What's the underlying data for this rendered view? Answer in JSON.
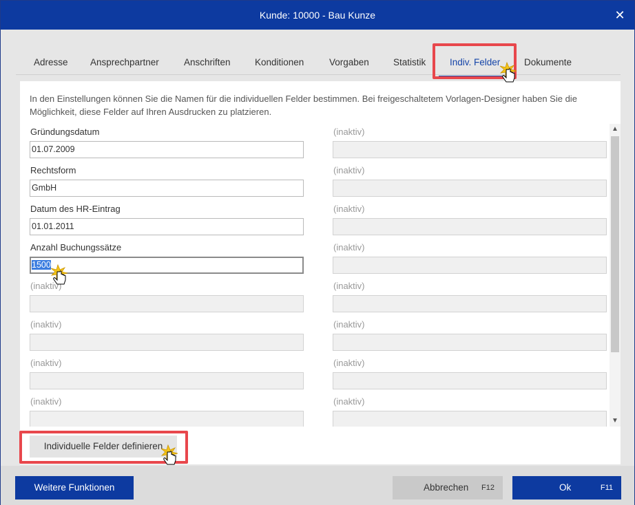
{
  "window": {
    "title": "Kunde: 10000 - Bau Kunze",
    "close_glyph": "✕"
  },
  "tabs": [
    {
      "label": "Adresse"
    },
    {
      "label": "Ansprechpartner"
    },
    {
      "label": "Anschriften"
    },
    {
      "label": "Konditionen"
    },
    {
      "label": "Vorgaben"
    },
    {
      "label": "Statistik"
    },
    {
      "label": "Indiv. Felder",
      "active": true
    },
    {
      "label": "Dokumente"
    }
  ],
  "intro": "In den Einstellungen können Sie die Namen für die individuellen Felder bestimmen. Bei freigeschaltetem Vorlagen-Designer haben Sie die Möglichkeit, diese Felder auf Ihren Ausdrucken zu platzieren.",
  "left_fields": [
    {
      "label": "Gründungsdatum",
      "value": "01.07.2009"
    },
    {
      "label": "Rechtsform",
      "value": "GmbH"
    },
    {
      "label": "Datum des HR-Eintrag",
      "value": "01.01.2011"
    },
    {
      "label": "Anzahl Buchungssätze",
      "value": "1500"
    },
    {
      "label": "(inaktiv)",
      "value": ""
    },
    {
      "label": "(inaktiv)",
      "value": ""
    },
    {
      "label": "(inaktiv)",
      "value": ""
    },
    {
      "label": "(inaktiv)",
      "value": ""
    }
  ],
  "right_fields": [
    {
      "label": "(inaktiv)",
      "value": ""
    },
    {
      "label": "(inaktiv)",
      "value": ""
    },
    {
      "label": "(inaktiv)",
      "value": ""
    },
    {
      "label": "(inaktiv)",
      "value": ""
    },
    {
      "label": "(inaktiv)",
      "value": ""
    },
    {
      "label": "(inaktiv)",
      "value": ""
    },
    {
      "label": "(inaktiv)",
      "value": ""
    },
    {
      "label": "(inaktiv)",
      "value": ""
    }
  ],
  "define_button": {
    "label": "Individuelle Felder definieren"
  },
  "footer": {
    "more_label": "Weitere Funktionen",
    "cancel_label": "Abbrechen",
    "cancel_key": "F12",
    "ok_label": "Ok",
    "ok_key": "F11"
  },
  "colors": {
    "brand": "#0d3aa0",
    "highlight": "#e8474c",
    "selection": "#3b7de0"
  },
  "icons": [
    "close-icon",
    "scroll-up-icon",
    "scroll-down-icon",
    "hand-cursor-icon"
  ]
}
